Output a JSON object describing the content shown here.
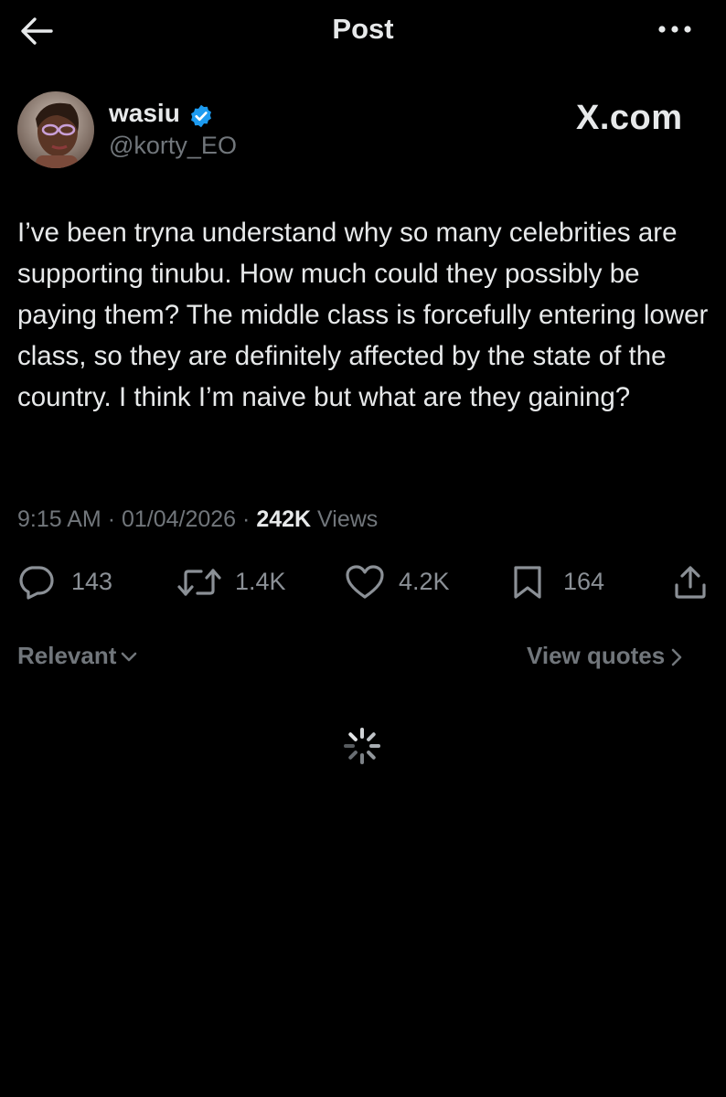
{
  "header": {
    "title": "Post",
    "back_icon": "arrow-left-icon",
    "more_icon": "more-horizontal-icon"
  },
  "author": {
    "display_name": "wasiu",
    "handle": "@korty_EO",
    "verified_icon": "verified-badge-icon",
    "verified_color": "#1d9bf0"
  },
  "watermark": "X.com",
  "tweet": {
    "text": "I’ve been tryna understand why so many celebrities are supporting tinubu. How much could they possibly be paying them? The middle class is forcefully entering lower class, so they are definitely affected by the state of the country. I think I’m naive but what are they gaining?"
  },
  "meta": {
    "time": "9:15 AM",
    "separator": "·",
    "date": "01/04/2026",
    "views_count": "242K",
    "views_label": "Views"
  },
  "actions": {
    "replies": "143",
    "reposts": "1.4K",
    "likes": "4.2K",
    "bookmarks": "164"
  },
  "replies_bar": {
    "sort_label": "Relevant",
    "quotes_label": "View quotes"
  },
  "loading": {
    "icon": "loading-spinner-icon"
  }
}
